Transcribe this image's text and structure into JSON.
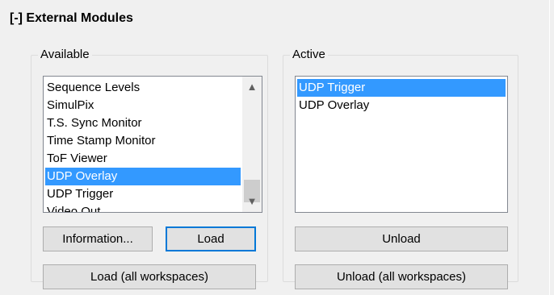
{
  "section": {
    "title": "[-] External Modules"
  },
  "available": {
    "legend": "Available",
    "items": [
      "Sequence Levels",
      "SimulPix",
      "T.S. Sync Monitor",
      "Time Stamp Monitor",
      "ToF Viewer",
      "UDP Overlay",
      "UDP Trigger",
      "Video Out"
    ],
    "selected": "UDP Overlay",
    "scroll_up_icon": "chevron-up",
    "scroll_down_icon": "chevron-down",
    "buttons": {
      "information": "Information...",
      "load": "Load",
      "load_all": "Load (all workspaces)"
    }
  },
  "active": {
    "legend": "Active",
    "items": [
      "UDP Trigger",
      "UDP Overlay"
    ],
    "selected": "UDP Trigger",
    "buttons": {
      "unload": "Unload",
      "unload_all": "Unload (all workspaces)"
    }
  },
  "colors": {
    "selection": "#3399ff",
    "focus_border": "#0078d7",
    "window_bg": "#f0f0f0"
  }
}
